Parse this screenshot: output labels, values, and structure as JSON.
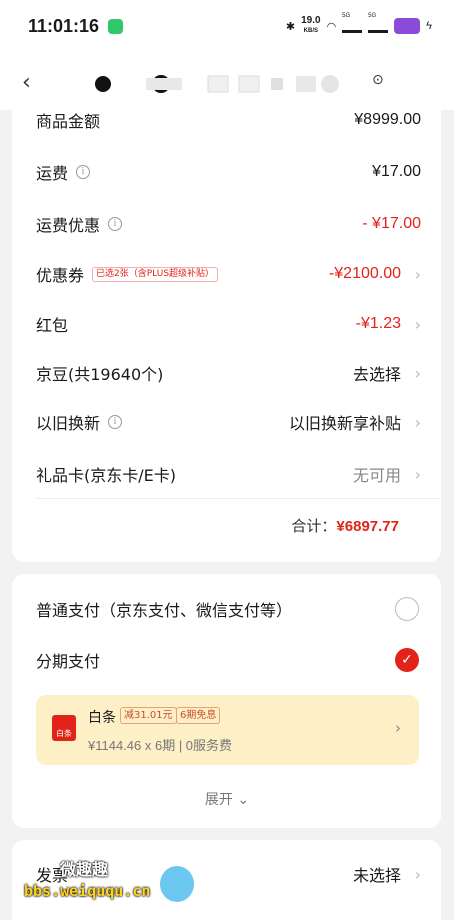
{
  "status_bar": {
    "time": "11:01:16",
    "net_speed_value": "19.0",
    "net_speed_unit": "KB/S",
    "sig1_label": "5G",
    "sig2_label": "5G"
  },
  "order_card": {
    "rows": [
      {
        "label": "商品金额",
        "value": "¥8999.00"
      },
      {
        "label": "运费",
        "value": "¥17.00"
      },
      {
        "label": "运费优惠",
        "value": "- ¥17.00"
      },
      {
        "label": "优惠券",
        "tag": "已选2张（含PLUS超级补贴）",
        "value": "-¥2100.00"
      },
      {
        "label": "红包",
        "value": "-¥1.23"
      },
      {
        "label": "京豆(共19640个)",
        "value": "去选择"
      },
      {
        "label": "以旧换新",
        "value": "以旧换新享补贴"
      },
      {
        "label": "礼品卡(京东卡/E卡)",
        "value": "无可用"
      }
    ],
    "total_label": "合计：",
    "total_value": "¥6897.77"
  },
  "payment_card": {
    "normal_pay_label": "普通支付（京东支付、微信支付等）",
    "installment_label": "分期支付",
    "baitiao": {
      "logo_text": "白条",
      "title": "白条",
      "tag1": "减31.01元",
      "tag2": "6期免息",
      "subtitle": "¥1144.46 x 6期 | 0服务费"
    },
    "expand_label": "展开"
  },
  "invoice_card": {
    "label": "发票",
    "value": "未选择"
  },
  "watermark": {
    "title": "微趣趣",
    "url": "bbs.weiququ.cn"
  },
  "colors": {
    "accent_red": "#e2231a",
    "baitiao_bg": "#fdefc6"
  }
}
